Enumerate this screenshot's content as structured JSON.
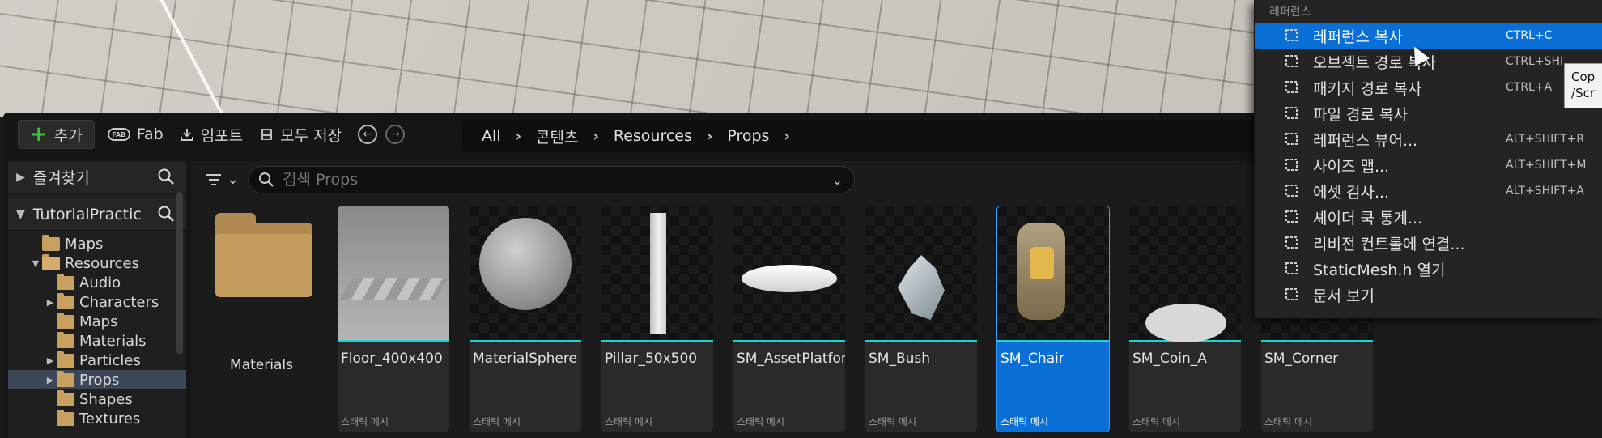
{
  "toolbar": {
    "add_label": "추가",
    "fab_label": "Fab",
    "import_label": "임포트",
    "save_all_label": "모두 저장"
  },
  "breadcrumb": [
    "All",
    "콘텐츠",
    "Resources",
    "Props"
  ],
  "sidebar": {
    "favorites_label": "즐겨찾기",
    "project_label": "TutorialPractic",
    "tree": [
      {
        "label": "Maps",
        "indent": 1,
        "expandable": false,
        "open": false,
        "selected": false
      },
      {
        "label": "Resources",
        "indent": 1,
        "expandable": true,
        "open": true,
        "selected": false
      },
      {
        "label": "Audio",
        "indent": 2,
        "expandable": false,
        "open": false,
        "selected": false
      },
      {
        "label": "Characters",
        "indent": 2,
        "expandable": true,
        "open": false,
        "selected": false
      },
      {
        "label": "Maps",
        "indent": 2,
        "expandable": false,
        "open": false,
        "selected": false
      },
      {
        "label": "Materials",
        "indent": 2,
        "expandable": false,
        "open": false,
        "selected": false
      },
      {
        "label": "Particles",
        "indent": 2,
        "expandable": true,
        "open": false,
        "selected": false
      },
      {
        "label": "Props",
        "indent": 2,
        "expandable": true,
        "open": false,
        "selected": true
      },
      {
        "label": "Shapes",
        "indent": 2,
        "expandable": false,
        "open": false,
        "selected": false
      },
      {
        "label": "Textures",
        "indent": 2,
        "expandable": false,
        "open": false,
        "selected": false
      }
    ]
  },
  "search": {
    "placeholder": "검색 Props"
  },
  "assets": [
    {
      "name": "Materials",
      "type": "",
      "kind": "folder",
      "selected": false
    },
    {
      "name": "Floor_400x400",
      "type": "스태틱 메시",
      "kind": "floor",
      "selected": false
    },
    {
      "name": "MaterialSphere",
      "type": "스태틱 메시",
      "kind": "sphere",
      "selected": false
    },
    {
      "name": "Pillar_50x500",
      "type": "스태틱 메시",
      "kind": "pillar",
      "selected": false
    },
    {
      "name": "SM_AssetPlatform",
      "type": "스태틱 메시",
      "kind": "platform",
      "selected": false
    },
    {
      "name": "SM_Bush",
      "type": "스태틱 메시",
      "kind": "bush",
      "selected": false
    },
    {
      "name": "SM_Chair",
      "type": "스태틱 메시",
      "kind": "chair",
      "selected": true
    },
    {
      "name": "SM_Coin_A",
      "type": "스태틱 메시",
      "kind": "coin",
      "selected": false
    },
    {
      "name": "SM_Corner",
      "type": "스태틱 메시",
      "kind": "corner",
      "selected": false
    }
  ],
  "context_menu": {
    "section_label": "레퍼런스",
    "items": [
      {
        "label": "레퍼런스 복사",
        "shortcut": "CTRL+C",
        "icon": "copy-reference-icon",
        "highlighted": true
      },
      {
        "label": "오브젝트 경로 복사",
        "shortcut": "CTRL+SHI",
        "icon": "copy-object-path-icon",
        "highlighted": false
      },
      {
        "label": "패키지 경로 복사",
        "shortcut": "CTRL+A",
        "icon": "copy-package-path-icon",
        "highlighted": false
      },
      {
        "label": "파일 경로 복사",
        "shortcut": "",
        "icon": "copy-file-path-icon",
        "highlighted": false
      },
      {
        "label": "레퍼런스 뷰어...",
        "shortcut": "ALT+SHIFT+R",
        "icon": "reference-viewer-icon",
        "highlighted": false
      },
      {
        "label": "사이즈 맵...",
        "shortcut": "ALT+SHIFT+M",
        "icon": "size-map-icon",
        "highlighted": false
      },
      {
        "label": "에셋 검사...",
        "shortcut": "ALT+SHIFT+A",
        "icon": "asset-audit-icon",
        "highlighted": false
      },
      {
        "label": "셰이더 쿡 통계...",
        "shortcut": "",
        "icon": "shader-cook-stats-icon",
        "highlighted": false
      },
      {
        "label": "리비전 컨트롤에 연결...",
        "shortcut": "",
        "icon": "revision-control-icon",
        "highlighted": false
      },
      {
        "label": "StaticMesh.h 열기",
        "shortcut": "",
        "icon": "cpp-file-icon",
        "highlighted": false
      },
      {
        "label": "문서 보기",
        "shortcut": "",
        "icon": "documentation-icon",
        "highlighted": false
      }
    ]
  },
  "tooltip": {
    "line1": "Cop",
    "line2": "/Scr"
  },
  "colors": {
    "accent": "#0a70d8",
    "asset_underline": "#1cd4d4",
    "folder": "#c8a060",
    "add_plus": "#3fc33f"
  }
}
